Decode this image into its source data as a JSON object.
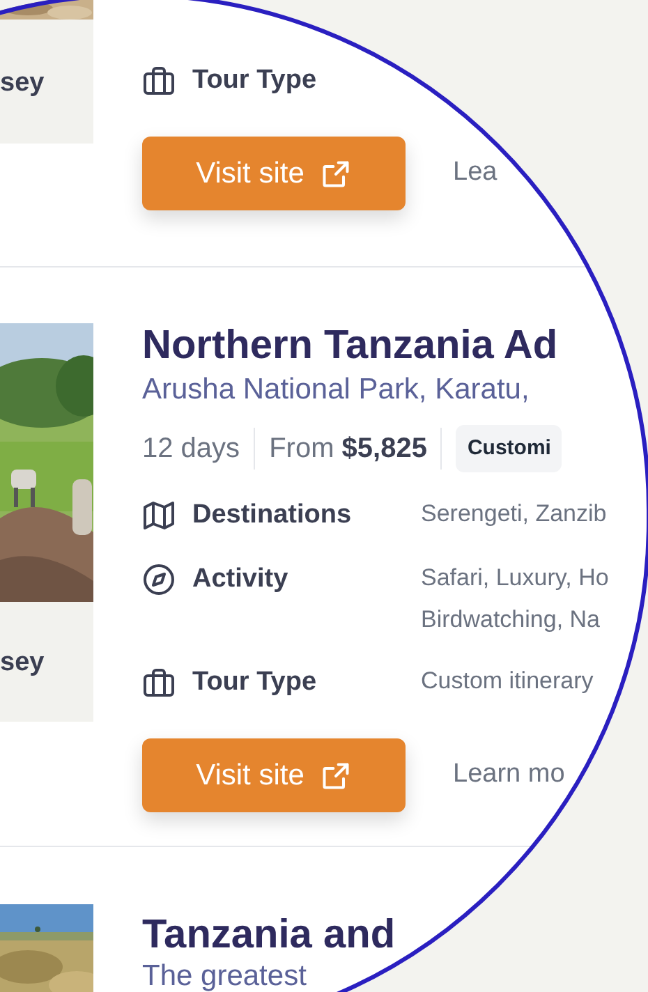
{
  "listings": [
    {
      "image": {
        "kind": "picture"
      },
      "side_label": "sey",
      "attributes": [
        {
          "kind": "suitcase",
          "label": "Tour Type"
        }
      ],
      "visit_button": "Visit site",
      "learn_link": "Lea"
    },
    {
      "image": {
        "kind": "picture"
      },
      "side_label": "sey",
      "title": "Northern Tanzania Ad",
      "subtitle": "Arusha National Park, Karatu,",
      "duration": "12 days",
      "price_prefix": "From",
      "price": "$5,825",
      "badge": "Customi",
      "attributes": [
        {
          "kind": "map",
          "label": "Destinations",
          "values": [
            "Serengeti, Zanzib"
          ]
        },
        {
          "kind": "compass",
          "label": "Activity",
          "values": [
            "Safari, Luxury, Ho",
            "Birdwatching, Na"
          ]
        },
        {
          "kind": "suitcase",
          "label": "Tour Type",
          "values": [
            "Custom itinerary"
          ]
        }
      ],
      "visit_button": "Visit site",
      "learn_link": "Learn mo"
    },
    {
      "image": {
        "kind": "picture"
      },
      "title": "Tanzania and",
      "subtitle": "The greatest"
    }
  ]
}
